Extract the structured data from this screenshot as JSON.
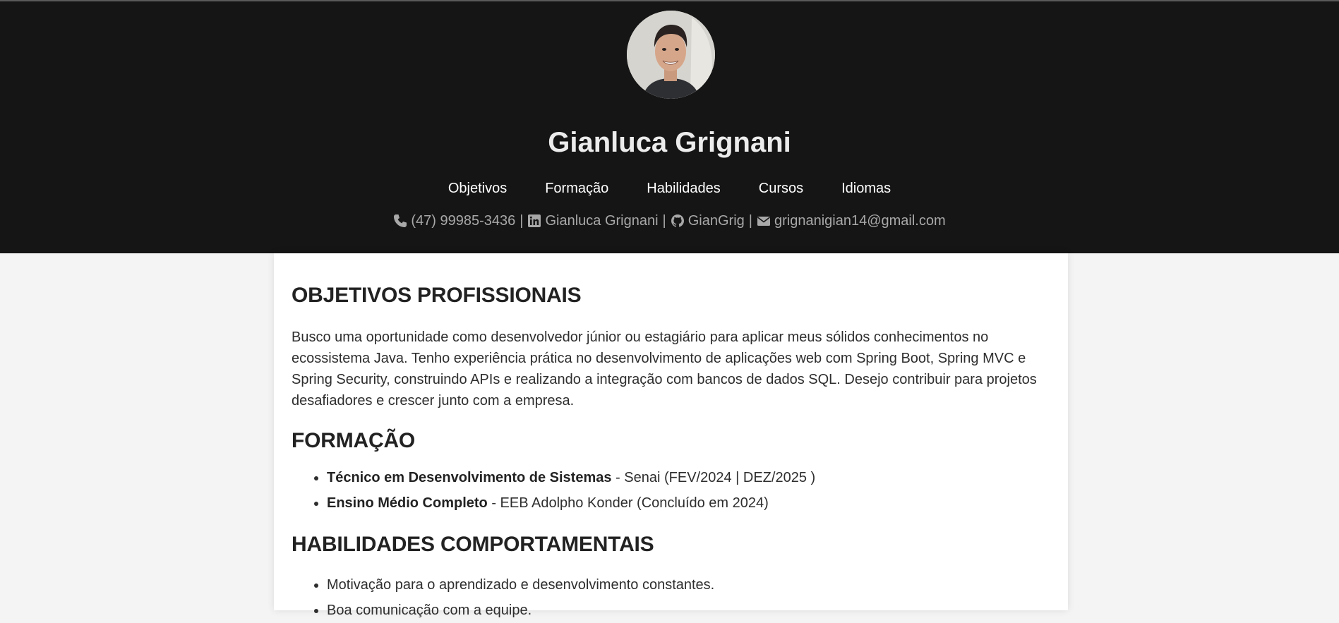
{
  "profile": {
    "name": "Gianluca Grignani",
    "avatar_icon": "profile-photo"
  },
  "nav": {
    "items": [
      "Objetivos",
      "Formação",
      "Habilidades",
      "Cursos",
      "Idiomas"
    ]
  },
  "contacts": {
    "phone": "(47) 99985-3436",
    "linkedin": "Gianluca Grignani",
    "github": "GianGrig",
    "email": "grignanigian14@gmail.com",
    "separator": "|",
    "icons": [
      "phone-icon",
      "linkedin-icon",
      "github-icon",
      "envelope-icon"
    ]
  },
  "sections": {
    "objetivos": {
      "title": "OBJETIVOS PROFISSIONAIS",
      "text": "Busco uma oportunidade como desenvolvedor júnior ou estagiário para aplicar meus sólidos conhecimentos no ecossistema Java. Tenho experiência prática no desenvolvimento de aplicações web com Spring Boot, Spring MVC e Spring Security, construindo APIs e realizando a integração com bancos de dados SQL. Desejo contribuir para projetos desafiadores e crescer junto com a empresa."
    },
    "formacao": {
      "title": "FORMAÇÃO",
      "items": [
        {
          "course": "Técnico em Desenvolvimento de Sistemas",
          "detail": " - Senai (FEV/2024 | DEZ/2025 )"
        },
        {
          "course": "Ensino Médio Completo",
          "detail": " - EEB Adolpho Konder (Concluído em 2024)"
        }
      ]
    },
    "habilidades": {
      "title": "HABILIDADES COMPORTAMENTAIS",
      "items": [
        "Motivação para o aprendizado e desenvolvimento constantes.",
        "Boa comunicação com a equipe."
      ]
    }
  },
  "colors": {
    "header_bg": "#151515",
    "page_bg": "#f4f4f4",
    "card_bg": "#ffffff",
    "contact_text": "#a8a8a8"
  }
}
